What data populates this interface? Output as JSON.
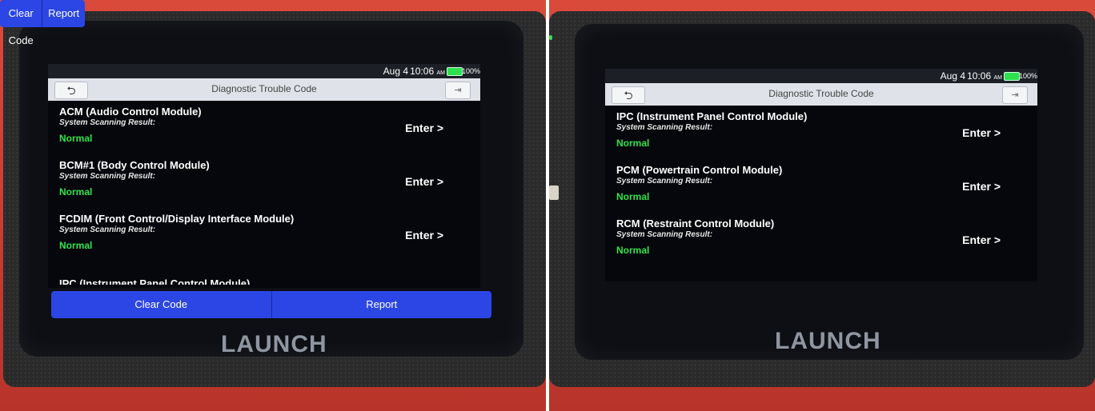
{
  "status": {
    "date": "Aug 4",
    "time": "10:06",
    "ampm": "AM",
    "battery": "100%"
  },
  "header": {
    "title": "Diagnostic Trouble Code",
    "back_icon": "back-arrow-icon",
    "exit_icon": "exit-icon"
  },
  "left_panel": {
    "items": [
      {
        "name": "ACM (Audio Control Module)",
        "label": "System Scanning Result:",
        "status": "Normal",
        "enter": "Enter >"
      },
      {
        "name": "BCM#1 (Body Control Module)",
        "label": "System Scanning Result:",
        "status": "Normal",
        "enter": "Enter >"
      },
      {
        "name": "FCDIM (Front Control/Display Interface Module)",
        "label": "System Scanning Result:",
        "status": "Normal",
        "enter": "Enter >"
      }
    ],
    "partial_item": "IPC (Instrument Panel Control Module)"
  },
  "right_panel": {
    "items": [
      {
        "name": "IPC (Instrument Panel Control Module)",
        "label": "System Scanning Result:",
        "status": "Normal",
        "enter": "Enter >"
      },
      {
        "name": "PCM (Powertrain Control Module)",
        "label": "System Scanning Result:",
        "status": "Normal",
        "enter": "Enter >"
      },
      {
        "name": "RCM (Restraint Control Module)",
        "label": "System Scanning Result:",
        "status": "Normal",
        "enter": "Enter >"
      }
    ]
  },
  "actions": {
    "clear_code": "Clear Code",
    "report": "Report"
  },
  "brand": "LAUNCH",
  "colors": {
    "accent_blue": "#2b46e4",
    "normal_green": "#34e34a",
    "device_red": "#c23a2e"
  }
}
